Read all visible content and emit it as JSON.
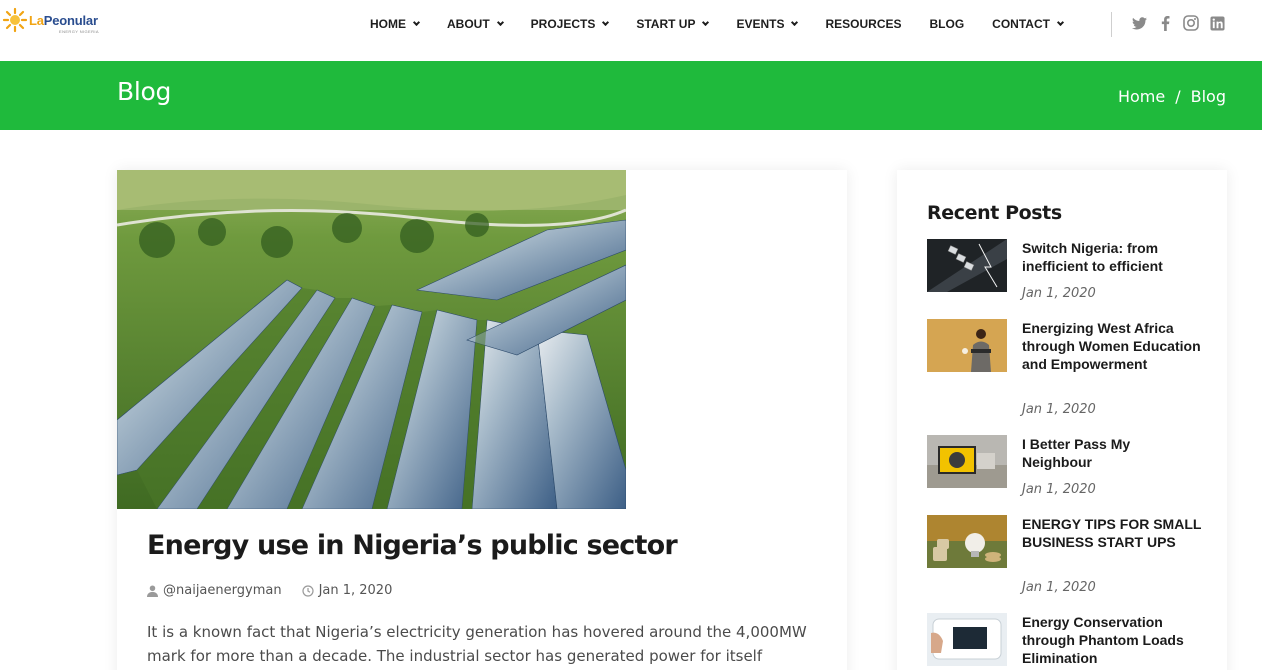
{
  "brand": {
    "name_prefix": "La",
    "name_rest": "Peonular",
    "tagline": "ENERGY NIGERIA"
  },
  "nav": {
    "items": [
      {
        "label": "HOME",
        "dropdown": true
      },
      {
        "label": "ABOUT",
        "dropdown": true
      },
      {
        "label": "PROJECTS",
        "dropdown": true
      },
      {
        "label": "START UP",
        "dropdown": true
      },
      {
        "label": "EVENTS",
        "dropdown": true
      },
      {
        "label": "RESOURCES",
        "dropdown": false
      },
      {
        "label": "BLOG",
        "dropdown": false
      },
      {
        "label": "CONTACT",
        "dropdown": true
      }
    ],
    "social": [
      "twitter-icon",
      "facebook-icon",
      "instagram-icon",
      "linkedin-icon"
    ]
  },
  "banner": {
    "title": "Blog",
    "breadcrumb": {
      "home": "Home",
      "separator": "/",
      "current": "Blog"
    }
  },
  "post": {
    "title": "Energy use in Nigeria’s public sector",
    "author": "@naijaenergyman",
    "date": "Jan 1, 2020",
    "excerpt": "It is a known fact that Nigeria’s electricity generation has hovered around the 4,000MW mark for more than a decade. The industrial sector has generated power for itself"
  },
  "sidebar": {
    "title": "Recent Posts",
    "posts": [
      {
        "title": "Switch Nigeria: from inefficient to efficient",
        "date": "Jan 1, 2020"
      },
      {
        "title": "Energizing West Africa through Women Education and Empowerment",
        "date": "Jan 1, 2020"
      },
      {
        "title": "I Better Pass My Neighbour",
        "date": "Jan 1, 2020"
      },
      {
        "title": "ENERGY TIPS FOR SMALL BUSINESS START UPS",
        "date": "Jan 1, 2020"
      },
      {
        "title": "Energy Conservation through Phantom Loads Elimination",
        "date": ""
      }
    ]
  },
  "colors": {
    "banner_green": "#1fba3c",
    "brand_blue": "#2a4d8f",
    "brand_orange": "#f1a414"
  }
}
